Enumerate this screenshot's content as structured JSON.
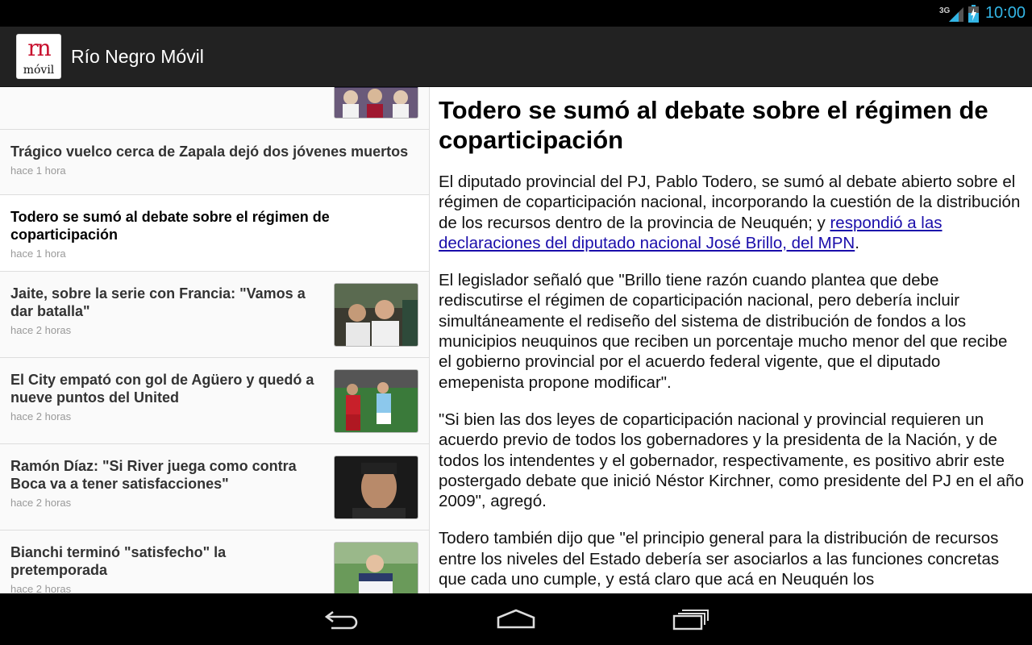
{
  "status_bar": {
    "network": "3G",
    "time": "10:00"
  },
  "action_bar": {
    "logo_top": "rn",
    "logo_bottom": "móvil",
    "title": "Río Negro Móvil"
  },
  "news_list": [
    {
      "title": "",
      "time": "",
      "has_thumb": true,
      "thumb": "soccer-team-photo"
    },
    {
      "title": "Trágico vuelco cerca de Zapala dejó dos jóvenes muertos",
      "time": "hace 1 hora",
      "has_thumb": false
    },
    {
      "title": "Todero se sumó al debate sobre el régimen de coparticipación",
      "time": "hace 1 hora",
      "has_thumb": false,
      "selected": true
    },
    {
      "title": "Jaite, sobre la serie con Francia: \"Vamos a dar batalla\"",
      "time": "hace 2 horas",
      "has_thumb": true,
      "thumb": "press-conference-photo"
    },
    {
      "title": "El City empató con gol de Agüero y quedó a nueve puntos del United",
      "time": "hace 2 horas",
      "has_thumb": true,
      "thumb": "football-match-photo"
    },
    {
      "title": "Ramón Díaz: \"Si River juega como contra Boca va a tener satisfacciones\"",
      "time": "hace 2 horas",
      "has_thumb": true,
      "thumb": "coach-portrait-photo"
    },
    {
      "title": "Bianchi terminó \"satisfecho\" la pretemporada",
      "time": "hace 2 horas",
      "has_thumb": true,
      "thumb": "coach-field-photo"
    }
  ],
  "article": {
    "title": "Todero se sumó al debate sobre el régimen de coparticipación",
    "p1_text": "El diputado provincial del PJ, Pablo Todero, se sumó al debate abierto sobre el régimen de coparticipación nacional, incorporando la cuestión de la distribución de los recursos dentro de la provincia de Neuquén; y ",
    "p1_link": "respondió a las declaraciones del diputado nacional José Brillo, del MPN",
    "p1_end": ".",
    "p2": "El legislador señaló que \"Brillo tiene razón cuando plantea que debe rediscutirse el régimen de coparticipación nacional, pero debería incluir simultáneamente el rediseño del sistema de distribución de fondos a los municipios neuquinos que reciben un porcentaje mucho menor del que recibe el gobierno provincial por el acuerdo federal vigente, que el diputado emepenista propone modificar\".",
    "p3": "\"Si bien las dos leyes de coparticipación nacional y provincial requieren un acuerdo previo de todos los gobernadores y la presidenta de la Nación, y de todos los intendentes y el gobernador, respectivamente, es positivo abrir este postergado debate que inició Néstor Kirchner, como presidente del PJ en el año 2009\", agregó.",
    "p4": "Todero también dijo que \"el principio general para la distribución de recursos entre los niveles del Estado debería ser asociarlos a las funciones concretas que cada uno cumple, y está claro que acá en Neuquén los"
  },
  "colors": {
    "clock": "#33b5e5",
    "logo_red": "#c8102e",
    "link": "#1a0dab"
  }
}
